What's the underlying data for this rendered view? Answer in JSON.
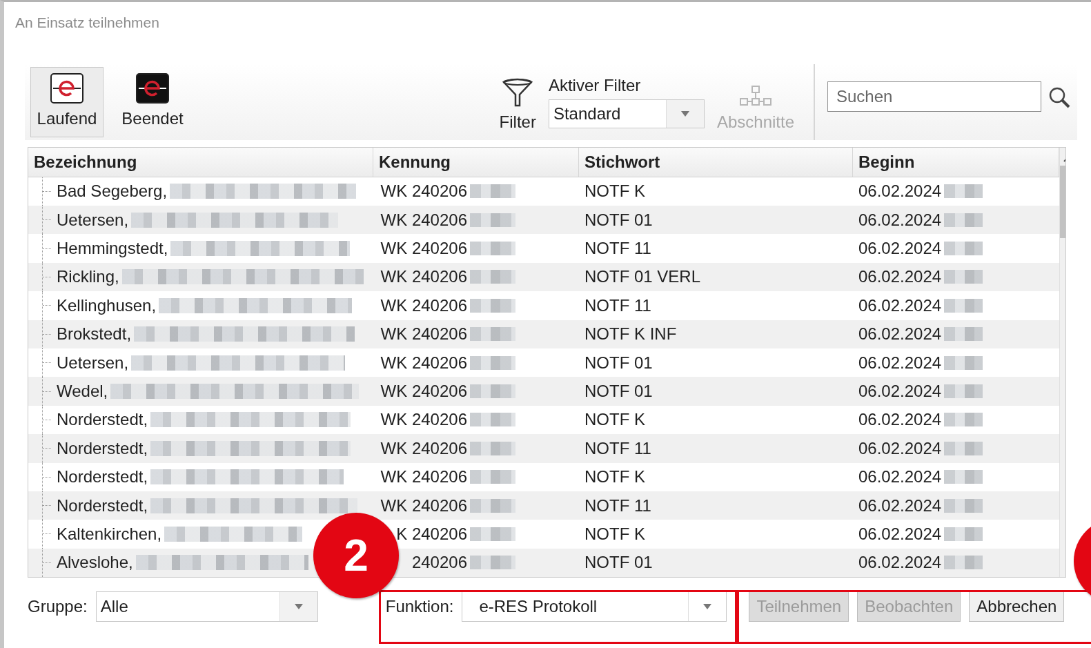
{
  "window": {
    "title": "An Einsatz teilnehmen"
  },
  "toolbar": {
    "views": [
      {
        "label": "Laufend",
        "selected": true
      },
      {
        "label": "Beendet",
        "selected": false
      }
    ],
    "filter": {
      "label": "Filter"
    },
    "active_filter": {
      "label": "Aktiver Filter",
      "value": "Standard"
    },
    "sections": {
      "label": "Abschnitte",
      "disabled": true
    },
    "search": {
      "placeholder": "Suchen"
    }
  },
  "table": {
    "columns": [
      "Bezeichnung",
      "Kennung",
      "Stichwort",
      "Beginn"
    ],
    "rows": [
      {
        "name": "Bad Segeberg,",
        "kennung": "WK 240206",
        "stichwort": "NOTF K",
        "beginn": "06.02.2024"
      },
      {
        "name": "Uetersen,",
        "kennung": "WK 240206",
        "stichwort": "NOTF 01",
        "beginn": "06.02.2024"
      },
      {
        "name": "Hemmingstedt,",
        "kennung": "WK 240206",
        "stichwort": "NOTF 11",
        "beginn": "06.02.2024"
      },
      {
        "name": "Rickling,",
        "kennung": "WK 240206",
        "stichwort": "NOTF 01 VERL",
        "beginn": "06.02.2024"
      },
      {
        "name": "Kellinghusen,",
        "kennung": "WK 240206",
        "stichwort": "NOTF 11",
        "beginn": "06.02.2024"
      },
      {
        "name": "Brokstedt,",
        "kennung": "WK 240206",
        "stichwort": "NOTF K INF",
        "beginn": "06.02.2024"
      },
      {
        "name": "Uetersen,",
        "kennung": "WK 240206",
        "stichwort": "NOTF 01",
        "beginn": "06.02.2024"
      },
      {
        "name": "Wedel,",
        "kennung": "WK 240206",
        "stichwort": "NOTF 01",
        "beginn": "06.02.2024"
      },
      {
        "name": "Norderstedt,",
        "kennung": "WK 240206",
        "stichwort": "NOTF K",
        "beginn": "06.02.2024"
      },
      {
        "name": "Norderstedt,",
        "kennung": "WK 240206",
        "stichwort": "NOTF 11",
        "beginn": "06.02.2024"
      },
      {
        "name": "Norderstedt,",
        "kennung": "WK 240206",
        "stichwort": "NOTF K",
        "beginn": "06.02.2024"
      },
      {
        "name": "Norderstedt,",
        "kennung": "WK 240206",
        "stichwort": "NOTF 11",
        "beginn": "06.02.2024"
      },
      {
        "name": "Kaltenkirchen,",
        "kennung": "K 240206",
        "stichwort": "NOTF K",
        "beginn": "06.02.2024"
      },
      {
        "name": "Alveslohe,",
        "kennung": "240206",
        "stichwort": "NOTF 01",
        "beginn": "06.02.2024"
      }
    ]
  },
  "bottom": {
    "group": {
      "label": "Gruppe:",
      "value": "Alle"
    },
    "function": {
      "label": "Funktion:",
      "value": "e-RES Protokoll"
    },
    "buttons": [
      {
        "label": "Teilnehmen",
        "disabled": true
      },
      {
        "label": "Beobachten",
        "disabled": true
      },
      {
        "label": "Abbrechen",
        "disabled": false
      }
    ]
  },
  "markers": [
    {
      "label": "2"
    }
  ]
}
